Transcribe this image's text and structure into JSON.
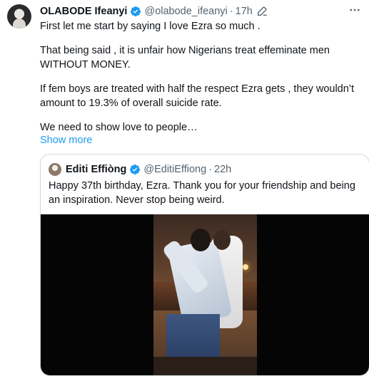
{
  "tweet": {
    "author_name": "OLABODE Ifeanyi",
    "handle": "@olabode_ifeanyi",
    "separator": "·",
    "time": "17h",
    "paragraphs": [
      "First let me start by saying I love Ezra so much .",
      "That being said , it is unfair how Nigerians treat effeminate men WITHOUT MONEY.",
      "If  fem boys are treated with half the respect Ezra gets , they wouldn’t amount to 19.3% of overall suicide rate.",
      "We need to show love to people…"
    ],
    "show_more": "Show more"
  },
  "quote": {
    "author_name": "Editi Effiòng",
    "handle": "@EditiEffiong",
    "separator": "·",
    "time": "22h",
    "text": "Happy 37th birthday, Ezra. Thank you for your friendship and being an inspiration. Never stop being weird."
  },
  "icons": {
    "verified": "verified-badge-icon",
    "edit": "edited-pencil-icon",
    "more": "more-options-icon"
  },
  "colors": {
    "accent": "#1d9bf0",
    "secondary_text": "#536471",
    "border": "#cfd9de"
  }
}
